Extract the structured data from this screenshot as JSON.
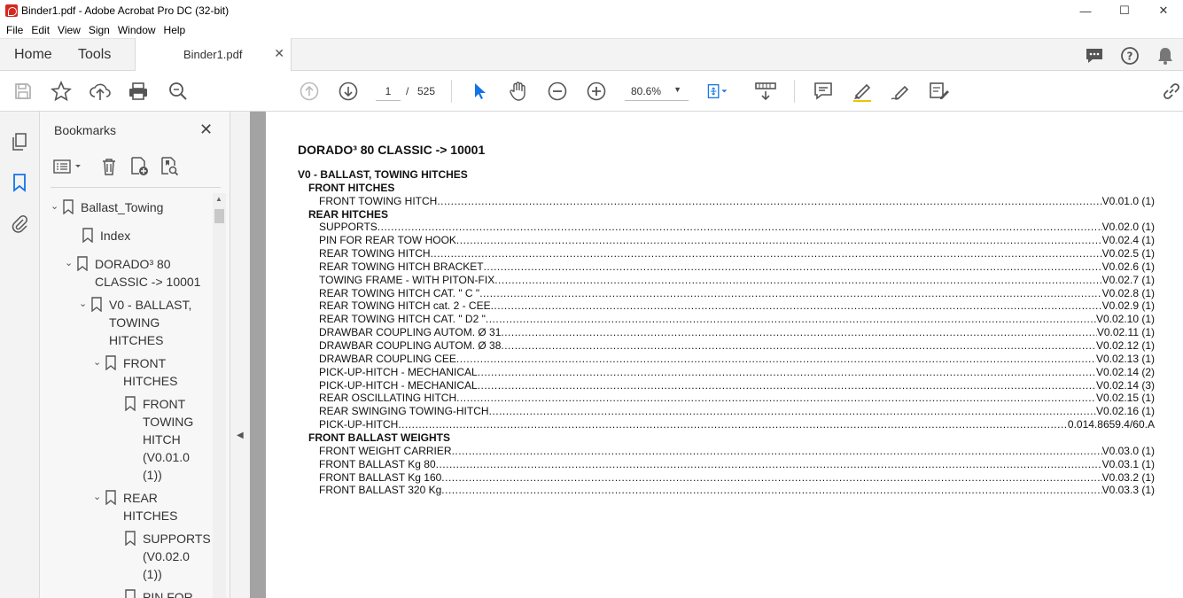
{
  "window": {
    "title": "Binder1.pdf - Adobe Acrobat Pro DC (32-bit)"
  },
  "menu": [
    "File",
    "Edit",
    "View",
    "Sign",
    "Window",
    "Help"
  ],
  "tabs": {
    "home": "Home",
    "tools": "Tools",
    "document": "Binder1.pdf"
  },
  "toolbar": {
    "page_current": "1",
    "page_separator": "/",
    "page_total": "525",
    "zoom": "80.6%"
  },
  "bookmarks": {
    "title": "Bookmarks",
    "items": [
      {
        "label": "Ballast_Towing",
        "lines": [
          "Ballast_Towing"
        ]
      },
      {
        "label": "Index",
        "lines": [
          "Index"
        ]
      },
      {
        "label": "DORADO³ 80 CLASSIC -> 10001",
        "lines": [
          "DORADO³ 80",
          "CLASSIC -> 10001"
        ]
      },
      {
        "label": "V0 - BALLAST, TOWING HITCHES",
        "lines": [
          "V0 - BALLAST,",
          "TOWING",
          "HITCHES"
        ]
      },
      {
        "label": "FRONT HITCHES",
        "lines": [
          "FRONT",
          "HITCHES"
        ]
      },
      {
        "label": "FRONT TOWING HITCH (V0.01.0 (1))",
        "lines": [
          "FRONT",
          "TOWING",
          "HITCH",
          "(V0.01.0",
          "(1))"
        ]
      },
      {
        "label": "REAR HITCHES",
        "lines": [
          "REAR",
          "HITCHES"
        ]
      },
      {
        "label": "SUPPORTS (V0.02.0 (1))",
        "lines": [
          "SUPPORTS",
          "(V0.02.0",
          "(1))"
        ]
      },
      {
        "label": "PIN FOR",
        "lines": [
          "PIN FOR"
        ]
      }
    ]
  },
  "document": {
    "title": "DORADO³ 80 CLASSIC -> 10001",
    "chapter": "V0 - BALLAST, TOWING HITCHES",
    "sections": [
      {
        "heading": "FRONT HITCHES",
        "entries": [
          {
            "name": "FRONT TOWING HITCH",
            "ref": "V0.01.0 (1)"
          }
        ]
      },
      {
        "heading": "REAR HITCHES",
        "entries": [
          {
            "name": "SUPPORTS",
            "ref": "V0.02.0 (1)"
          },
          {
            "name": "PIN FOR REAR TOW HOOK",
            "ref": "V0.02.4 (1)"
          },
          {
            "name": "REAR TOWING HITCH",
            "ref": "V0.02.5 (1)"
          },
          {
            "name": "REAR TOWING HITCH BRACKET",
            "ref": "V0.02.6 (1)"
          },
          {
            "name": "TOWING FRAME - WITH PITON-FIX",
            "ref": "V0.02.7 (1)"
          },
          {
            "name": "REAR TOWING HITCH CAT. \" C \"",
            "ref": "V0.02.8 (1)"
          },
          {
            "name": "REAR TOWING HITCH cat. 2 - CEE",
            "ref": "V0.02.9 (1)"
          },
          {
            "name": "REAR TOWING HITCH CAT. \" D2 \"",
            "ref": "V0.02.10 (1)"
          },
          {
            "name": "DRAWBAR COUPLING AUTOM. Ø 31",
            "ref": "V0.02.11 (1)"
          },
          {
            "name": "DRAWBAR COUPLING AUTOM. Ø 38",
            "ref": "V0.02.12 (1)"
          },
          {
            "name": "DRAWBAR COUPLING CEE",
            "ref": "V0.02.13 (1)"
          },
          {
            "name": "PICK-UP-HITCH - MECHANICAL",
            "ref": "V0.02.14 (2)"
          },
          {
            "name": "PICK-UP-HITCH - MECHANICAL",
            "ref": "V0.02.14 (3)"
          },
          {
            "name": "REAR OSCILLATING HITCH",
            "ref": "V0.02.15 (1)"
          },
          {
            "name": "REAR SWINGING TOWING-HITCH",
            "ref": "V0.02.16 (1)"
          },
          {
            "name": "PICK-UP-HITCH",
            "ref": "0.014.8659.4/60.A"
          }
        ]
      },
      {
        "heading": "FRONT BALLAST WEIGHTS",
        "entries": [
          {
            "name": "FRONT WEIGHT CARRIER",
            "ref": "V0.03.0 (1)"
          },
          {
            "name": "FRONT BALLAST Kg 80",
            "ref": "V0.03.1 (1)"
          },
          {
            "name": "FRONT BALLAST Kg 160",
            "ref": "V0.03.2 (1)"
          },
          {
            "name": "FRONT BALLAST 320 Kg",
            "ref": "V0.03.3 (1)"
          }
        ]
      }
    ]
  }
}
